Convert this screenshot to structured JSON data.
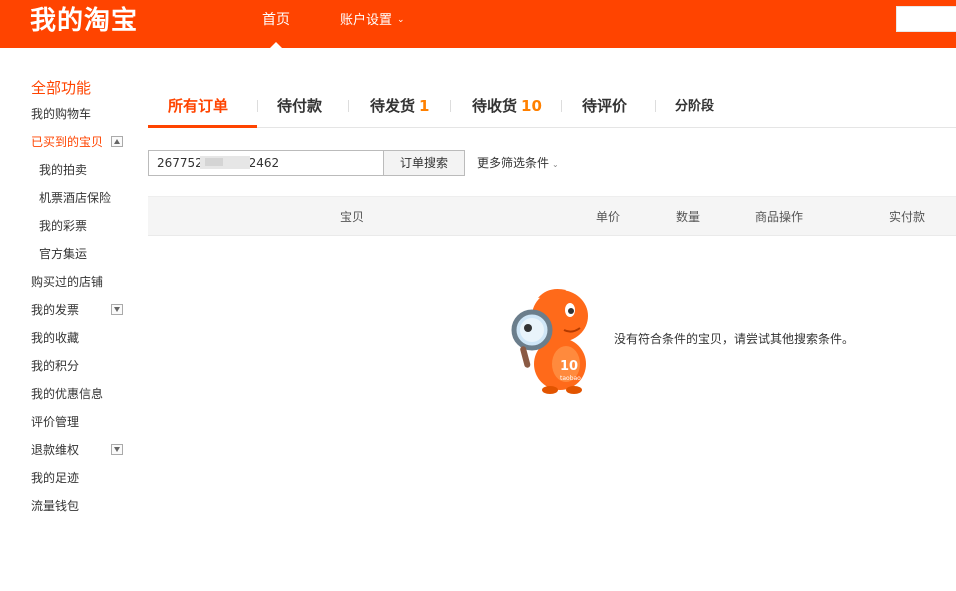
{
  "header": {
    "logo": "我的淘宝",
    "nav": {
      "home": "首页",
      "account_settings": "账户设置",
      "account_chevron": "⌄"
    }
  },
  "sidebar": {
    "title": "全部功能",
    "items": [
      {
        "label": "我的购物车"
      },
      {
        "label": "已买到的宝贝",
        "toggle": "up",
        "active": true
      },
      {
        "label": "我的拍卖",
        "sub": true
      },
      {
        "label": "机票酒店保险",
        "sub": true
      },
      {
        "label": "我的彩票",
        "sub": true
      },
      {
        "label": "官方集运",
        "sub": true
      },
      {
        "label": "购买过的店铺"
      },
      {
        "label": "我的发票",
        "toggle": "down"
      },
      {
        "label": "我的收藏"
      },
      {
        "label": "我的积分"
      },
      {
        "label": "我的优惠信息"
      },
      {
        "label": "评价管理"
      },
      {
        "label": "退款维权",
        "toggle": "down"
      },
      {
        "label": "我的足迹"
      },
      {
        "label": "流量钱包"
      }
    ]
  },
  "tabs": [
    {
      "label": "所有订单",
      "active": true
    },
    {
      "label": "待付款"
    },
    {
      "label": "待发货",
      "count": "1"
    },
    {
      "label": "待收货",
      "count": "10"
    },
    {
      "label": "待评价"
    },
    {
      "label": "分阶段"
    }
  ],
  "search": {
    "order_value": "267752         .42462",
    "button": "订单搜索",
    "more_filters": "更多筛选条件"
  },
  "table": {
    "columns": [
      "宝贝",
      "单价",
      "数量",
      "商品操作",
      "实付款"
    ]
  },
  "empty": {
    "message": "没有符合条件的宝贝，请尝试其他搜索条件。",
    "mascot_text": "taobao"
  },
  "colors": {
    "brand": "#ff4400",
    "count": "#ff8000"
  }
}
